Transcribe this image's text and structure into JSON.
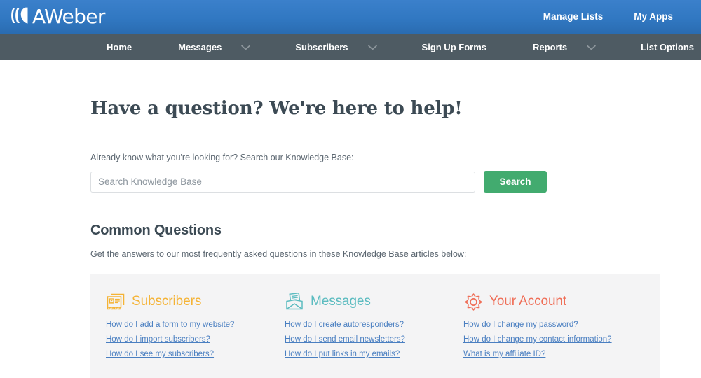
{
  "brand": {
    "name": "AWeber",
    "logo_icon": "aweber-logo-icon"
  },
  "topbar": {
    "links": [
      {
        "label": "Manage Lists",
        "name": "manage-lists"
      },
      {
        "label": "My Apps",
        "name": "my-apps"
      }
    ]
  },
  "nav": {
    "items": [
      {
        "label": "Home",
        "caret": false
      },
      {
        "label": "Messages",
        "caret": true
      },
      {
        "label": "Subscribers",
        "caret": true
      },
      {
        "label": "Sign Up Forms",
        "caret": false
      },
      {
        "label": "Reports",
        "caret": true
      },
      {
        "label": "List Options",
        "caret": false
      }
    ]
  },
  "main": {
    "title": "Have a question? We're here to help!",
    "search": {
      "label": "Already know what you're looking for? Search our Knowledge Base:",
      "placeholder": "Search Knowledge Base",
      "value": "",
      "button_label": "Search"
    },
    "common_questions": {
      "title": "Common Questions",
      "subtitle": "Get the answers to our most frequently asked questions in these Knowledge Base articles below:",
      "columns": [
        {
          "title": "Subscribers",
          "icon": "contact-card-icon",
          "color": "#f5b335",
          "links": [
            "How do I add a form to my website?",
            "How do I import subscribers?",
            "How do I see my subscribers?"
          ]
        },
        {
          "title": "Messages",
          "icon": "envelope-letter-icon",
          "color": "#5cbcc0",
          "links": [
            "How do I create autoresponders?",
            "How do I send email newsletters?",
            "How do I put links in my emails?"
          ]
        },
        {
          "title": "Your Account",
          "icon": "gear-icon",
          "color": "#ef6d56",
          "links": [
            "How do I change my password?",
            "How do I change my contact information?",
            "What is my affiliate ID?"
          ]
        }
      ]
    }
  },
  "colors": {
    "header_blue": "#3178c2",
    "nav_slate": "#4e5b63",
    "accent_green": "#42ab6f",
    "link_blue": "#4a7fc1",
    "panel_grey": "#f4f4f5"
  }
}
